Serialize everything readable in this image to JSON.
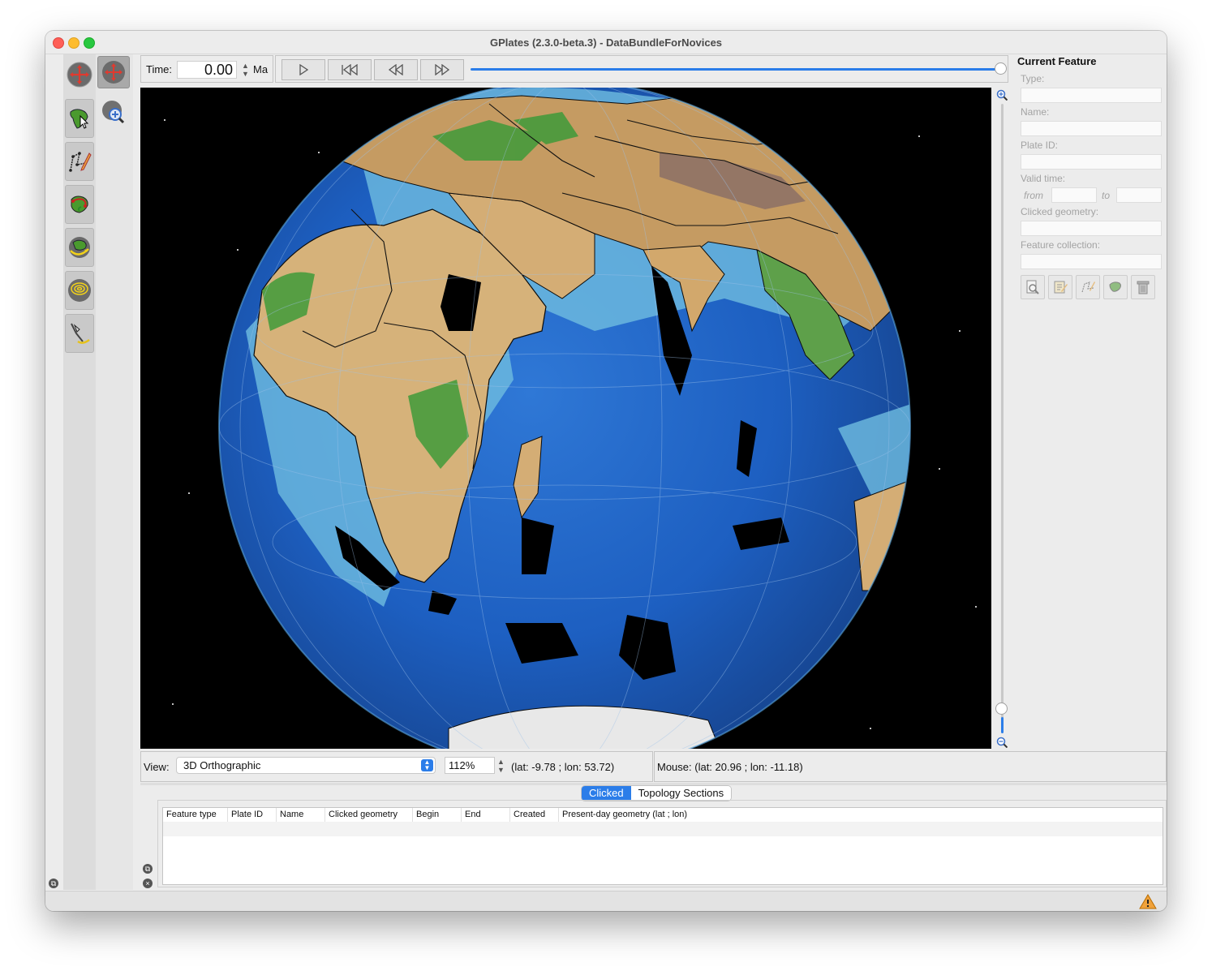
{
  "window": {
    "title": "GPlates (2.3.0-beta.3) - DataBundleForNovices"
  },
  "tool_palette": {
    "tools": [
      {
        "name": "drag-globe-tool",
        "icon": "drag-globe-icon"
      },
      {
        "name": "zoom-globe-tool",
        "icon": "zoom-globe-icon"
      },
      {
        "name": "choose-feature-tool",
        "icon": "choose-feature-icon"
      },
      {
        "name": "digitise-geometry-tool",
        "icon": "digitise-geometry-icon"
      },
      {
        "name": "topology-tool",
        "icon": "topology-icon"
      },
      {
        "name": "pole-manipulation-tool",
        "icon": "pole-manipulation-icon"
      },
      {
        "name": "small-circle-tool",
        "icon": "small-circle-icon"
      },
      {
        "name": "measure-distance-tool",
        "icon": "measure-distance-icon"
      }
    ]
  },
  "time_control": {
    "label": "Time:",
    "value": "0.00",
    "unit": "Ma"
  },
  "playback": {
    "buttons": [
      "play",
      "reset",
      "step-back",
      "step-forward"
    ],
    "slider_fraction": 1.0
  },
  "zoom_slider": {
    "fraction": 0.03
  },
  "current_feature": {
    "heading": "Current Feature",
    "type_label": "Type:",
    "name_label": "Name:",
    "plate_id_label": "Plate ID:",
    "valid_time_label": "Valid time:",
    "from_label": "from",
    "to_label": "to",
    "clicked_geometry_label": "Clicked geometry:",
    "feature_collection_label": "Feature collection:",
    "actions": [
      "query-feature-icon",
      "edit-feature-icon",
      "change-geometry-icon",
      "reconstruction-plate-icon",
      "delete-feature-icon"
    ]
  },
  "view_bar": {
    "view_label": "View:",
    "projection": "3D Orthographic",
    "zoom": "112%",
    "camera_coords": "(lat: -9.78 ; lon: 53.72)",
    "mouse_coords": "Mouse: (lat: 20.96 ; lon: -11.18)"
  },
  "bottom_tabs": {
    "clicked": "Clicked",
    "topology": "Topology Sections"
  },
  "clicked_table": {
    "columns": [
      "Feature type",
      "Plate ID",
      "Name",
      "Clicked geometry",
      "Begin",
      "End",
      "Created",
      "Present-day geometry (lat ; lon)"
    ]
  },
  "colors": {
    "accent": "#2b7de9",
    "ocean": "#1f5fbf",
    "land": "#d8b57e",
    "lowland": "#3f9a3a",
    "space": "#000000"
  }
}
